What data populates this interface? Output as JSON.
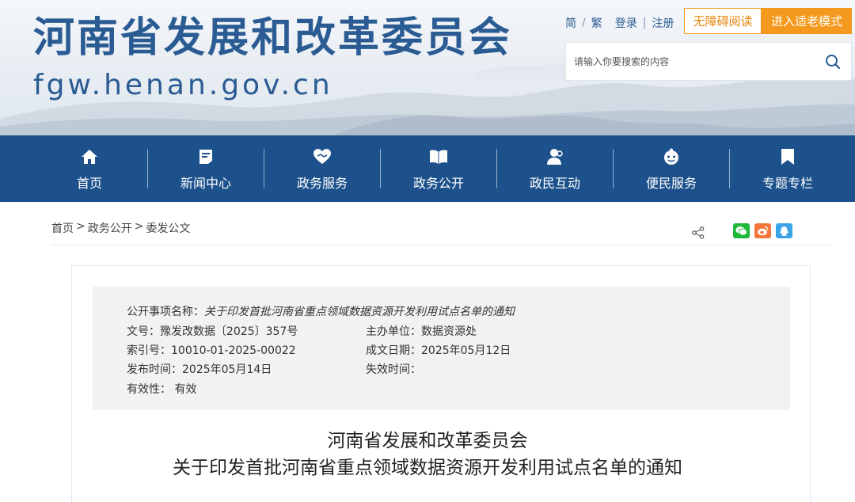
{
  "header": {
    "title": "河南省发展和改革委员会",
    "domain": "fgw.henan.gov.cn",
    "links": {
      "simplified": "简",
      "traditional": "繁",
      "login": "登录",
      "register": "注册"
    },
    "accessibility_button": "无障碍阅读",
    "elder_mode_button": "进入适老模式",
    "search_placeholder": "请输入你要搜索的内容"
  },
  "nav": {
    "items": [
      {
        "label": "首页",
        "icon": "home-icon"
      },
      {
        "label": "新闻中心",
        "icon": "news-icon"
      },
      {
        "label": "政务服务",
        "icon": "heart-hands-icon"
      },
      {
        "label": "政务公开",
        "icon": "book-icon"
      },
      {
        "label": "政民互动",
        "icon": "people-icon"
      },
      {
        "label": "便民服务",
        "icon": "convenience-icon"
      },
      {
        "label": "专题专栏",
        "icon": "bookmark-icon"
      }
    ]
  },
  "breadcrumb": {
    "home": "首页",
    "sep": ">",
    "section": "政务公开",
    "current": "委发公文"
  },
  "colors": {
    "brand_blue": "#1c518c",
    "title_blue": "#2a5b93",
    "accent_orange": "#f39a1e",
    "wechat_green": "#20b83a",
    "weibo_orange": "#f3753a",
    "qq_blue": "#3aa3e8"
  },
  "meta": {
    "item_name_label": "公开事项名称：",
    "item_name_value": "关于印发首批河南省重点领域数据资源开发利用试点名单的通知",
    "doc_no_label": "文号：",
    "doc_no_value": "豫发改数据〔2025〕357号",
    "host_label": "主办单位：",
    "host_value": "数据资源处",
    "index_label": "索引号：",
    "index_value": "10010-01-2025-00022",
    "created_label": "成文日期：",
    "created_value": "2025年05月12日",
    "published_label": "发布时间：",
    "published_value": "2025年05月14日",
    "expiry_label": "失效时间：",
    "expiry_value": "",
    "validity_label": "有效性：",
    "validity_value": "有效"
  },
  "document": {
    "title_line1": "河南省发展和改革委员会",
    "title_line2": "关于印发首批河南省重点领域数据资源开发利用试点名单的通知"
  }
}
